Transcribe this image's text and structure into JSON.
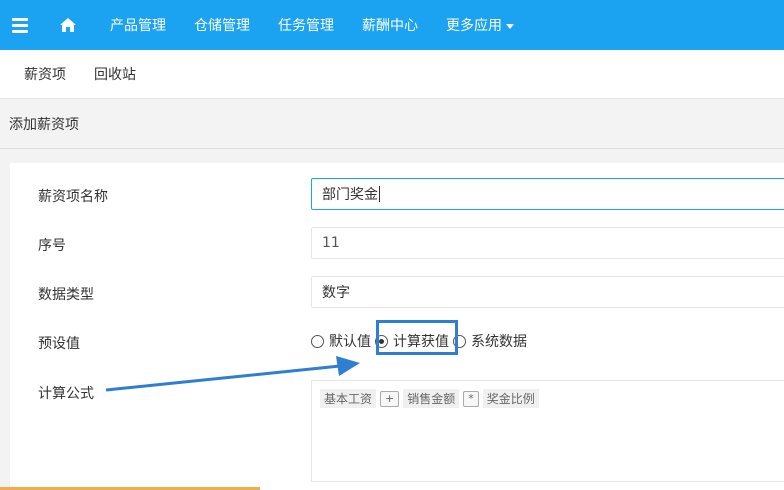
{
  "topbar": {
    "menu_icon": "hamburger-icon",
    "home_icon": "home-icon",
    "items": [
      {
        "label": "产品管理"
      },
      {
        "label": "仓储管理"
      },
      {
        "label": "任务管理"
      },
      {
        "label": "薪酬中心"
      },
      {
        "label": "更多应用"
      }
    ]
  },
  "subnav": {
    "items": [
      {
        "label": "薪资项"
      },
      {
        "label": "回收站"
      }
    ]
  },
  "breadcrumb": {
    "title": "添加薪资项"
  },
  "form": {
    "name_label": "薪资项名称",
    "name_value": "部门奖金",
    "seq_label": "序号",
    "seq_value": "11",
    "type_label": "数据类型",
    "type_value": "数字",
    "preset_label": "预设值",
    "preset_options": [
      {
        "label": "默认值",
        "checked": false
      },
      {
        "label": "计算获值",
        "checked": true
      },
      {
        "label": "系统数据",
        "checked": false
      }
    ],
    "formula_label": "计算公式",
    "formula_tokens": {
      "t1": "基本工资",
      "op1": "+",
      "t2": "销售金额",
      "op2": "*",
      "t3": "奖金比例"
    }
  },
  "colors": {
    "brand": "#1ba2f0",
    "annotation": "#2e7fd1"
  }
}
